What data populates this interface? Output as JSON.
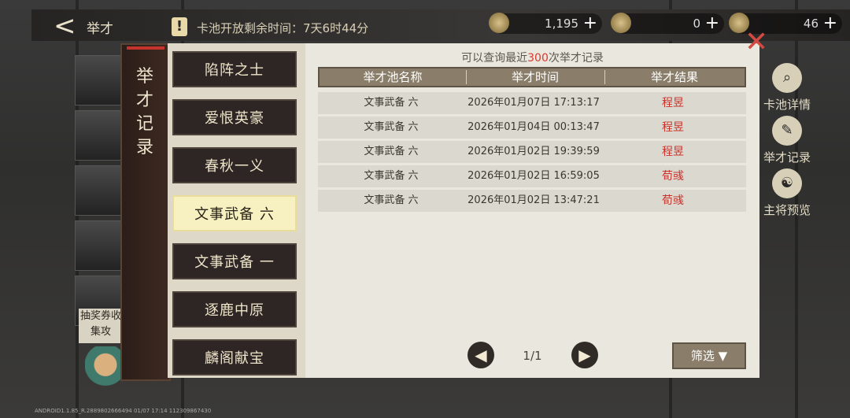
{
  "header": {
    "back_glyph": "<",
    "title": "举才",
    "warn_glyph": "!",
    "timer_text": "卡池开放剩余时间：7天6时44分"
  },
  "currencies": [
    {
      "icon": "coin-icon",
      "value": "1,195",
      "plus": "+"
    },
    {
      "icon": "token-icon",
      "value": "0",
      "plus": "+"
    },
    {
      "icon": "jade-icon",
      "value": "46",
      "plus": "+"
    }
  ],
  "background": {
    "hint_text": "抽奖券收集攻"
  },
  "right_menu": [
    {
      "icon": "search-icon",
      "label": "卡池详情"
    },
    {
      "icon": "brush-icon",
      "label": "举才记录"
    },
    {
      "icon": "preview-icon",
      "label": "主将预览"
    }
  ],
  "modal": {
    "title": "举才记录",
    "tabs": [
      "陷阵之士",
      "爱恨英豪",
      "春秋一义",
      "文事武备 六",
      "文事武备 一",
      "逐鹿中原",
      "麟阁献宝"
    ],
    "active_tab": "文事武备 六",
    "subtitle_prefix": "可以查询最近",
    "subtitle_num": "300",
    "subtitle_suffix": "次举才记录",
    "columns": [
      "举才池名称",
      "举才时间",
      "举才结果"
    ],
    "rows": [
      {
        "pool": "文事武备 六",
        "time": "2026年01月07日 17:13:17",
        "result": "程昱"
      },
      {
        "pool": "文事武备 六",
        "time": "2026年01月04日 00:13:47",
        "result": "程昱"
      },
      {
        "pool": "文事武备 六",
        "time": "2026年01月02日 19:39:59",
        "result": "程昱"
      },
      {
        "pool": "文事武备 六",
        "time": "2026年01月02日 16:59:05",
        "result": "荀彧"
      },
      {
        "pool": "文事武备 六",
        "time": "2026年01月02日 13:47:21",
        "result": "荀彧"
      }
    ],
    "page_indicator": "1/1",
    "filter_label": "筛选",
    "close_glyph": "✕"
  },
  "version_text": "ANDROID1.1.85_R.2889802666494 01/07 17:14 112309867430",
  "colors": {
    "accent_red": "#c9332b",
    "active_tab_bg": "#f7f0c0",
    "header_bg": "#8a7e6a"
  }
}
